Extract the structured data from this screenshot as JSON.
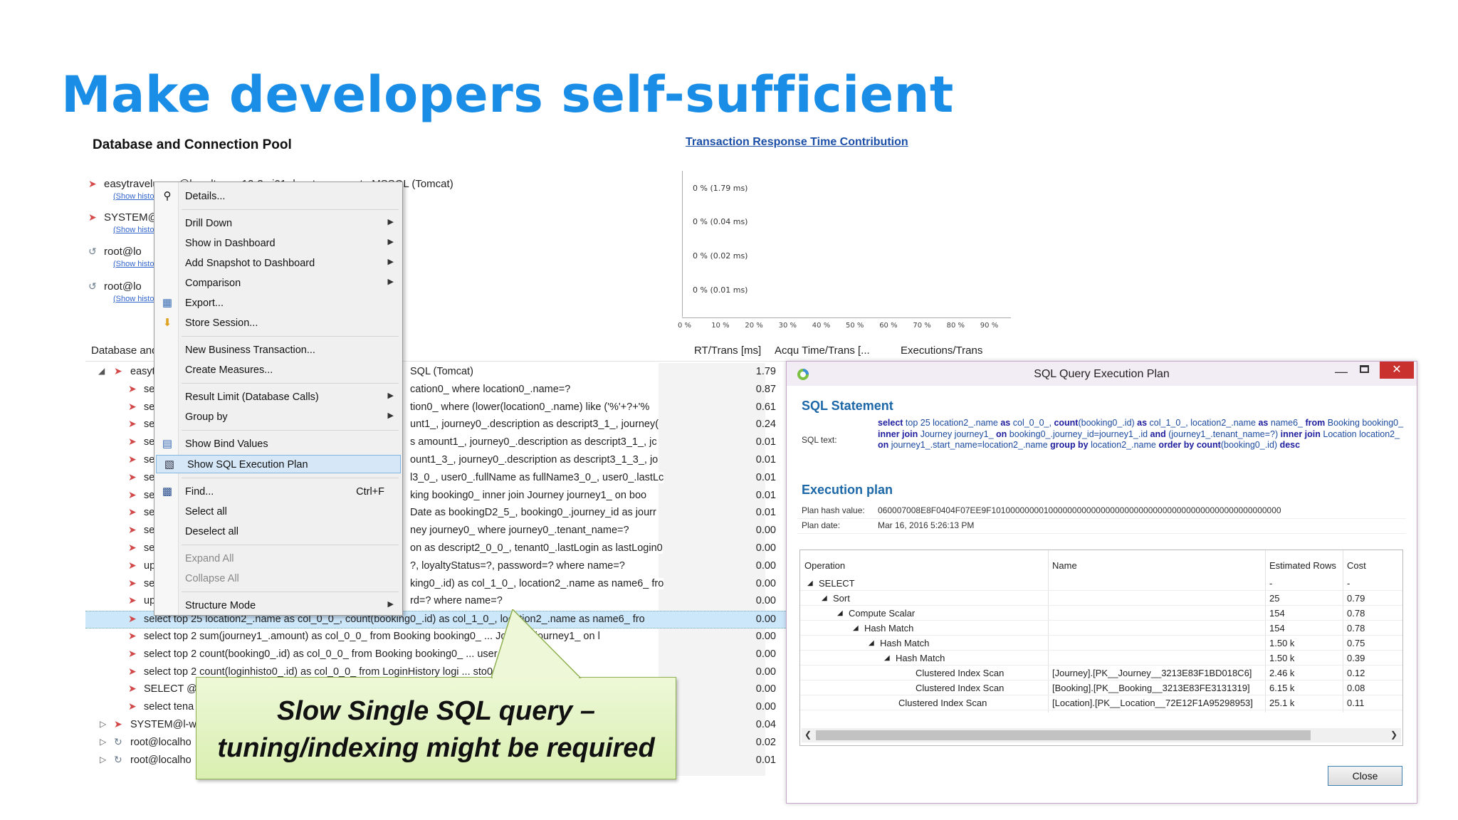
{
  "slide": {
    "title": "Make developers self-sufficient",
    "callout_line1": "Slow Single SQL query –",
    "callout_line2": "tuning/indexing might be required"
  },
  "pool": {
    "section_title": "Database and Connection Pool",
    "items": [
      {
        "text": "easytravelusers@lon-dt-w...e12r3-sj01 dynatrace-ucmte MSSQL (Tomcat)",
        "link": "(Show histo"
      },
      {
        "text": "SYSTEM@...  .0.0/easyTravel\\database.net\\PaymentData.sdf)",
        "link": "(Show histo"
      },
      {
        "text": "root@lo",
        "link": "(Show histo"
      },
      {
        "text": "root@lo",
        "link": "(Show histo"
      }
    ]
  },
  "chart_data": {
    "type": "bar",
    "title": "Transaction Response Time Contribution",
    "labels": [
      "0 % (1.79 ms)",
      "0 % (0.04 ms)",
      "0 % (0.02 ms)",
      "0 % (0.01 ms)"
    ],
    "values": [
      0,
      0,
      0,
      0
    ],
    "x_ticks": [
      "0 %",
      "10 %",
      "20 %",
      "30 %",
      "40 %",
      "50 %",
      "60 %",
      "70 %",
      "80 %",
      "90 %"
    ],
    "xlim": [
      0,
      100
    ]
  },
  "table": {
    "headers": {
      "name": "Database and Connection Pool",
      "rt": "RT/Trans [ms]",
      "acqu": "Acqu Time/Trans [...",
      "exec": "Executions/Trans"
    },
    "rows": [
      {
        "text": "easytravelusers@... SQL (Tomcat)",
        "val": "1.79",
        "visible": "SQL (Tomcat)"
      },
      {
        "text": "se",
        "visible": "cation0_ where location0_.name=?",
        "val": "0.87"
      },
      {
        "text": "se",
        "visible": "tion0_ where (lower(location0_.name) like ('%'+?+'%",
        "val": "0.61"
      },
      {
        "text": "se",
        "visible": "unt1_, journey0_.description as descript3_1_, journey(",
        "val": "0.24"
      },
      {
        "text": "se",
        "visible": "s amount1_, journey0_.description as descript3_1_, jc",
        "val": "0.01"
      },
      {
        "text": "se",
        "visible": "ount1_3_, journey0_.description as descript3_1_3_, jo",
        "val": "0.01"
      },
      {
        "text": "se",
        "visible": "l3_0_, user0_.fullName as fullName3_0_, user0_.lastLc",
        "val": "0.01"
      },
      {
        "text": "se",
        "visible": "king booking0_ inner join Journey journey1_ on boo",
        "val": "0.01"
      },
      {
        "text": "se",
        "visible": "Date as bookingD2_5_, booking0_.journey_id as jourr",
        "val": "0.01"
      },
      {
        "text": "se",
        "visible": "ney journey0_ where journey0_.tenant_name=?",
        "val": "0.00"
      },
      {
        "text": "se",
        "visible": "on as descript2_0_0_, tenant0_.lastLogin as lastLogin0",
        "val": "0.00"
      },
      {
        "text": "up",
        "visible": "?, loyaltyStatus=?, password=? where name=?",
        "val": "0.00"
      },
      {
        "text": "se",
        "visible": "king0_.id) as col_1_0_, location2_.name as name6_ fro",
        "val": "0.00"
      },
      {
        "text": "up",
        "visible": "rd=? where name=?",
        "val": "0.00"
      },
      {
        "text": "select top 25 location2_.name as col_0_0_, count(booking0_.id) as col_1_0_, location2_.name as name6_ fro",
        "val": "0.00"
      },
      {
        "text": "select top 2 sum(journey1_.amount) as col_0_0_ from Booking booking0_  ...  Journey journey1_ on l",
        "val": "0.00"
      },
      {
        "text": "select top 2 count(booking0_.id) as col_0_0_ from Booking booking0_ ...  user_name<>?",
        "val": "0.00"
      },
      {
        "text": "select top 2 count(loginhisto0_.id) as col_0_0_ from LoginHistory logi ... sto0_.user_nan",
        "val": "0.00"
      },
      {
        "text": "SELECT @",
        "val": "0.00"
      },
      {
        "text": "select tena",
        "val": "0.00"
      },
      {
        "text": "SYSTEM@l-w",
        "val": "0.04"
      },
      {
        "text": "root@localho",
        "val": "0.02"
      },
      {
        "text": "root@localho",
        "val": "0.01"
      }
    ]
  },
  "menu": {
    "details": "Details...",
    "drill_down": "Drill Down",
    "show_in_dashboard": "Show in Dashboard",
    "add_snapshot": "Add Snapshot to Dashboard",
    "comparison": "Comparison",
    "export": "Export...",
    "store_session": "Store Session...",
    "new_bt": "New Business Transaction...",
    "create_measures": "Create Measures...",
    "result_limit": "Result Limit (Database Calls)",
    "group_by": "Group by",
    "show_bind": "Show Bind Values",
    "show_sql_plan": "Show SQL Execution Plan",
    "find": "Find...",
    "find_shortcut": "Ctrl+F",
    "select_all": "Select all",
    "deselect_all": "Deselect all",
    "expand_all": "Expand All",
    "collapse_all": "Collapse All",
    "structure_mode": "Structure Mode"
  },
  "dialog": {
    "title": "SQL Query Execution Plan",
    "sql_statement_heading": "SQL Statement",
    "sql_text_label": "SQL text:",
    "execution_plan_heading": "Execution plan",
    "plan_hash_label": "Plan hash value:",
    "plan_hash_value": "060007008E8F0404F07EE9F1010000000010000000000000000000000000000000000000000000000000",
    "plan_date_label": "Plan date:",
    "plan_date_value": "Mar 16, 2016 5:26:13 PM",
    "columns": {
      "operation": "Operation",
      "name": "Name",
      "rows": "Estimated Rows",
      "cost": "Cost"
    },
    "plan_rows": [
      {
        "op": "SELECT",
        "name": "",
        "rows": "-",
        "cost": "-"
      },
      {
        "op": "Sort",
        "name": "",
        "rows": "25",
        "cost": "0.79"
      },
      {
        "op": "Compute Scalar",
        "name": "",
        "rows": "154",
        "cost": "0.78"
      },
      {
        "op": "Hash Match",
        "name": "",
        "rows": "154",
        "cost": "0.78"
      },
      {
        "op": "Hash Match",
        "name": "",
        "rows": "1.50 k",
        "cost": "0.75"
      },
      {
        "op": "Hash Match",
        "name": "",
        "rows": "1.50 k",
        "cost": "0.39"
      },
      {
        "op": "Clustered Index Scan",
        "name": "[Journey].[PK__Journey__3213E83F1BD018C6]",
        "rows": "2.46 k",
        "cost": "0.12"
      },
      {
        "op": "Clustered Index Scan",
        "name": "[Booking].[PK__Booking__3213E83FE3131319]",
        "rows": "6.15 k",
        "cost": "0.08"
      },
      {
        "op": "Clustered Index Scan",
        "name": "[Location].[PK__Location__72E12F1A95298953]",
        "rows": "25.1 k",
        "cost": "0.11"
      }
    ],
    "close_label": "Close",
    "sql": {
      "p1": "select",
      "p2": " top 25 location2_.name ",
      "p3": "as",
      "p4": " col_0_0_, ",
      "p5": "count",
      "p6": "(booking0_.id) ",
      "p7": "as",
      "p8": " col_1_0_, location2_.name ",
      "p9": "as",
      "p10": " name6_ ",
      "p11": "from",
      "p12": " Booking booking0_ ",
      "p13": "inner join",
      "p14": " Journey journey1_ ",
      "p15": "on",
      "p16": " booking0_.journey_id=journey1_.id ",
      "p17": "and",
      "p18": " (journey1_.tenant_name=?) ",
      "p19": "inner join",
      "p20": " Location location2_ ",
      "p21": "on",
      "p22": " journey1_.start_name=location2_.name ",
      "p23": "group by",
      "p24": " location2_.name ",
      "p25": "order by",
      "p26": " ",
      "p27": "count",
      "p28": "(booking0_.id) ",
      "p29": "desc"
    }
  }
}
